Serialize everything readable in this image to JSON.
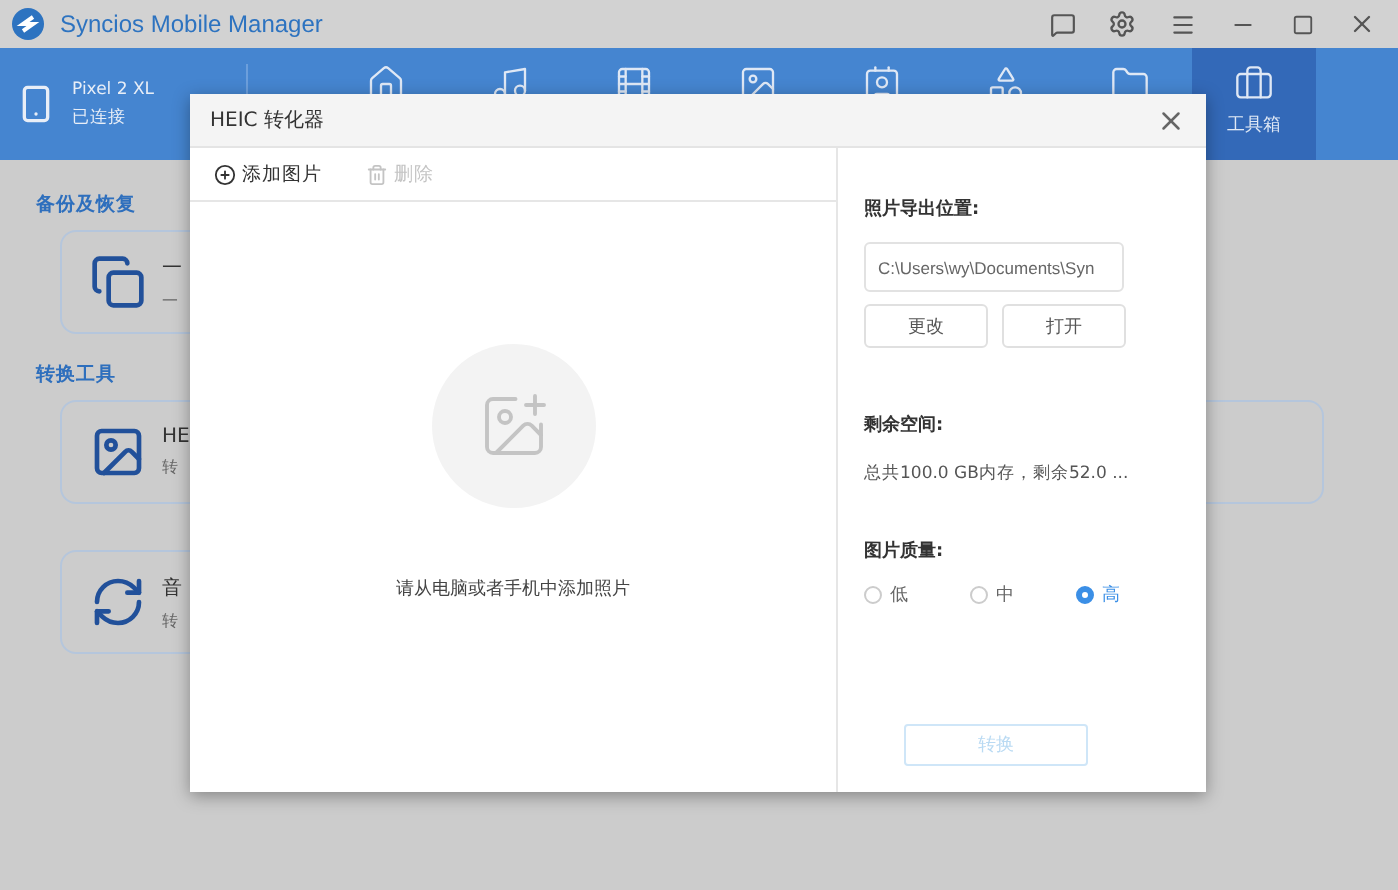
{
  "app": {
    "title": "Syncios Mobile Manager"
  },
  "device": {
    "name": "Pixel 2 XL",
    "status": "已连接"
  },
  "nav_tabs": [
    {
      "kind": "home",
      "selected": false
    },
    {
      "kind": "music",
      "selected": false
    },
    {
      "kind": "video",
      "selected": false
    },
    {
      "kind": "photo",
      "selected": false
    },
    {
      "kind": "contact",
      "selected": false
    },
    {
      "kind": "apps",
      "selected": false
    },
    {
      "kind": "folder",
      "selected": false
    },
    {
      "kind": "toolbox",
      "label": "工具箱",
      "selected": true
    }
  ],
  "sections": [
    {
      "title": "备份及恢复",
      "cards": [
        {
          "kind": "backup",
          "title": "一",
          "subtitle": "一"
        }
      ]
    },
    {
      "title": "转换工具",
      "cards": [
        {
          "kind": "heic",
          "title": "HE",
          "subtitle": "转"
        },
        {
          "kind": "blank"
        },
        {
          "kind": "audio",
          "title": "音",
          "subtitle": "转"
        }
      ]
    }
  ],
  "dialog": {
    "title": "HEIC 转化器",
    "toolbar": [
      {
        "kind": "add",
        "label": "添加图片",
        "disabled": false
      },
      {
        "kind": "delete",
        "label": "删除",
        "disabled": true
      }
    ],
    "empty_message": "请从电脑或者手机中添加照片",
    "export_label": "照片导出位置:",
    "export_path": "C:\\Users\\wy\\Documents\\Syn",
    "path_buttons": [
      "更改",
      "打开"
    ],
    "space_label": "剩余空间:",
    "space_value": "总共100.0 GB内存，剩余52.0 ...",
    "quality_label": "图片质量:",
    "quality_options": [
      {
        "label": "低",
        "selected": false
      },
      {
        "label": "中",
        "selected": false
      },
      {
        "label": "高",
        "selected": true
      }
    ],
    "convert_button": {
      "label": "转换",
      "disabled": true
    }
  }
}
